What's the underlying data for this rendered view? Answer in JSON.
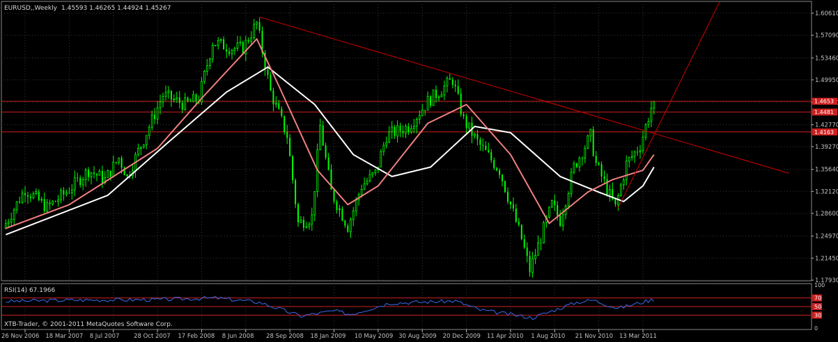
{
  "window": {
    "symbol": "EURUSD,,Weekly",
    "ohlc": "1.45593 1.46265 1.44924 1.45267",
    "copyright": "XTB-Trader, © 2001-2011 MetaQuotes Software Corp."
  },
  "colors": {
    "background": "#000000",
    "grid": "#3a3a3a",
    "axis": "#c0c0c0",
    "bull": "#00ff00",
    "bear": "#00ff00",
    "ma_fast": "#f08080",
    "ma_slow": "#ffffff",
    "trendline": "#d00000",
    "level_line": "#d02020",
    "rsi_line": "#3a6cf0",
    "rsi_level": "#d02020"
  },
  "chart_data": [
    {
      "type": "candlestick",
      "timeframe": "Weekly",
      "y_ticks": [
        "1.60610",
        "1.57090",
        "1.53460",
        "1.49950",
        "1.46330",
        "1.42770",
        "1.39270",
        "1.35640",
        "1.32120",
        "1.28600",
        "1.24970",
        "1.21450",
        "1.17930"
      ],
      "ylim": [
        1.17,
        1.61
      ],
      "x_ticks": [
        "26 Nov 2006",
        "18 Mar 2007",
        "8 Jul 2007",
        "28 Oct 2007",
        "17 Feb 2008",
        "8 Jun 2008",
        "28 Sep 2008",
        "18 Jan 2009",
        "10 May 2009",
        "30 Aug 2009",
        "20 Dec 2009",
        "11 Apr 2010",
        "1 Aug 2010",
        "21 Nov 2010",
        "13 Mar 2011"
      ],
      "x_tick_dates": [
        "2006-11-26",
        "2007-03-18",
        "2007-07-08",
        "2007-10-28",
        "2008-02-17",
        "2008-06-08",
        "2008-09-28",
        "2009-01-18",
        "2009-05-10",
        "2009-08-30",
        "2009-12-20",
        "2010-04-11",
        "2010-08-01",
        "2010-11-21",
        "2011-03-13"
      ],
      "price_path": [
        {
          "date": "2006-10-08",
          "price": 1.262
        },
        {
          "date": "2006-12-03",
          "price": 1.325
        },
        {
          "date": "2007-01-28",
          "price": 1.295
        },
        {
          "date": "2007-03-18",
          "price": 1.32
        },
        {
          "date": "2007-05-13",
          "price": 1.355
        },
        {
          "date": "2007-06-24",
          "price": 1.34
        },
        {
          "date": "2007-07-29",
          "price": 1.375
        },
        {
          "date": "2007-08-19",
          "price": 1.345
        },
        {
          "date": "2007-10-07",
          "price": 1.415
        },
        {
          "date": "2007-11-18",
          "price": 1.475
        },
        {
          "date": "2008-01-13",
          "price": 1.46
        },
        {
          "date": "2008-02-17",
          "price": 1.47
        },
        {
          "date": "2008-03-23",
          "price": 1.56
        },
        {
          "date": "2008-05-11",
          "price": 1.55
        },
        {
          "date": "2008-06-08",
          "price": 1.55
        },
        {
          "date": "2008-07-13",
          "price": 1.59
        },
        {
          "date": "2008-08-17",
          "price": 1.48
        },
        {
          "date": "2008-09-28",
          "price": 1.41
        },
        {
          "date": "2008-10-26",
          "price": 1.27
        },
        {
          "date": "2008-11-30",
          "price": 1.28
        },
        {
          "date": "2008-12-21",
          "price": 1.425
        },
        {
          "date": "2009-01-18",
          "price": 1.32
        },
        {
          "date": "2009-03-01",
          "price": 1.265
        },
        {
          "date": "2009-04-05",
          "price": 1.33
        },
        {
          "date": "2009-05-10",
          "price": 1.35
        },
        {
          "date": "2009-06-07",
          "price": 1.41
        },
        {
          "date": "2009-08-02",
          "price": 1.425
        },
        {
          "date": "2009-09-20",
          "price": 1.465
        },
        {
          "date": "2009-11-22",
          "price": 1.5
        },
        {
          "date": "2009-12-20",
          "price": 1.435
        },
        {
          "date": "2010-01-24",
          "price": 1.4
        },
        {
          "date": "2010-03-21",
          "price": 1.355
        },
        {
          "date": "2010-05-16",
          "price": 1.245
        },
        {
          "date": "2010-06-06",
          "price": 1.195
        },
        {
          "date": "2010-08-01",
          "price": 1.3
        },
        {
          "date": "2010-08-22",
          "price": 1.275
        },
        {
          "date": "2010-09-26",
          "price": 1.36
        },
        {
          "date": "2010-11-07",
          "price": 1.41
        },
        {
          "date": "2010-11-21",
          "price": 1.365
        },
        {
          "date": "2011-01-09",
          "price": 1.295
        },
        {
          "date": "2011-02-06",
          "price": 1.365
        },
        {
          "date": "2011-03-13",
          "price": 1.395
        },
        {
          "date": "2011-04-10",
          "price": 1.455
        }
      ],
      "ma_fast_path": [
        {
          "date": "2006-10-08",
          "price": 1.262
        },
        {
          "date": "2007-03-18",
          "price": 1.3
        },
        {
          "date": "2007-10-28",
          "price": 1.39
        },
        {
          "date": "2008-02-17",
          "price": 1.47
        },
        {
          "date": "2008-07-06",
          "price": 1.565
        },
        {
          "date": "2008-08-31",
          "price": 1.49
        },
        {
          "date": "2008-12-07",
          "price": 1.355
        },
        {
          "date": "2009-02-22",
          "price": 1.3
        },
        {
          "date": "2009-05-10",
          "price": 1.33
        },
        {
          "date": "2009-09-13",
          "price": 1.43
        },
        {
          "date": "2009-12-20",
          "price": 1.46
        },
        {
          "date": "2010-04-11",
          "price": 1.38
        },
        {
          "date": "2010-07-18",
          "price": 1.27
        },
        {
          "date": "2010-10-24",
          "price": 1.32
        },
        {
          "date": "2010-12-26",
          "price": 1.34
        },
        {
          "date": "2011-03-13",
          "price": 1.355
        },
        {
          "date": "2011-04-10",
          "price": 1.38
        }
      ],
      "ma_slow_path": [
        {
          "date": "2006-10-08",
          "price": 1.252
        },
        {
          "date": "2007-06-24",
          "price": 1.315
        },
        {
          "date": "2007-11-25",
          "price": 1.4
        },
        {
          "date": "2008-04-20",
          "price": 1.48
        },
        {
          "date": "2008-08-03",
          "price": 1.52
        },
        {
          "date": "2008-11-30",
          "price": 1.46
        },
        {
          "date": "2009-03-08",
          "price": 1.38
        },
        {
          "date": "2009-06-14",
          "price": 1.345
        },
        {
          "date": "2009-09-20",
          "price": 1.36
        },
        {
          "date": "2010-01-10",
          "price": 1.425
        },
        {
          "date": "2010-04-11",
          "price": 1.415
        },
        {
          "date": "2010-08-15",
          "price": 1.345
        },
        {
          "date": "2010-11-21",
          "price": 1.32
        },
        {
          "date": "2011-01-23",
          "price": 1.305
        },
        {
          "date": "2011-03-13",
          "price": 1.33
        },
        {
          "date": "2011-04-10",
          "price": 1.36
        }
      ],
      "trendlines": [
        {
          "from": {
            "date": "2008-07-13",
            "price": 1.6
          },
          "to": {
            "date": "2012-03-18",
            "price": 1.35
          }
        },
        {
          "from": {
            "date": "2011-01-09",
            "price": 1.295
          },
          "to": {
            "date": "2011-10-02",
            "price": 1.635
          }
        }
      ],
      "horizontal_levels": [
        {
          "price": 1.4653,
          "label": "1.4653"
        },
        {
          "price": 1.4481,
          "label": "1.4481"
        },
        {
          "price": 1.4163,
          "label": "1.4163"
        }
      ]
    },
    {
      "type": "line",
      "indicator": "RSI(14)",
      "label": "RSI(14) 67.1966",
      "ylim": [
        0,
        100
      ],
      "y_ticks": [
        "100",
        "70",
        "50",
        "30",
        "0"
      ],
      "levels": [
        70,
        50,
        30
      ],
      "rsi_path": [
        {
          "date": "2006-10-08",
          "value": 62
        },
        {
          "date": "2007-03-18",
          "value": 65
        },
        {
          "date": "2007-10-28",
          "value": 66
        },
        {
          "date": "2008-03-23",
          "value": 70
        },
        {
          "date": "2008-07-13",
          "value": 60
        },
        {
          "date": "2008-10-26",
          "value": 28
        },
        {
          "date": "2009-01-18",
          "value": 40
        },
        {
          "date": "2009-03-01",
          "value": 32
        },
        {
          "date": "2009-06-07",
          "value": 58
        },
        {
          "date": "2009-11-22",
          "value": 63
        },
        {
          "date": "2010-01-24",
          "value": 42
        },
        {
          "date": "2010-06-06",
          "value": 24
        },
        {
          "date": "2010-09-26",
          "value": 60
        },
        {
          "date": "2010-11-07",
          "value": 65
        },
        {
          "date": "2011-01-09",
          "value": 46
        },
        {
          "date": "2011-04-10",
          "value": 67
        }
      ]
    }
  ]
}
